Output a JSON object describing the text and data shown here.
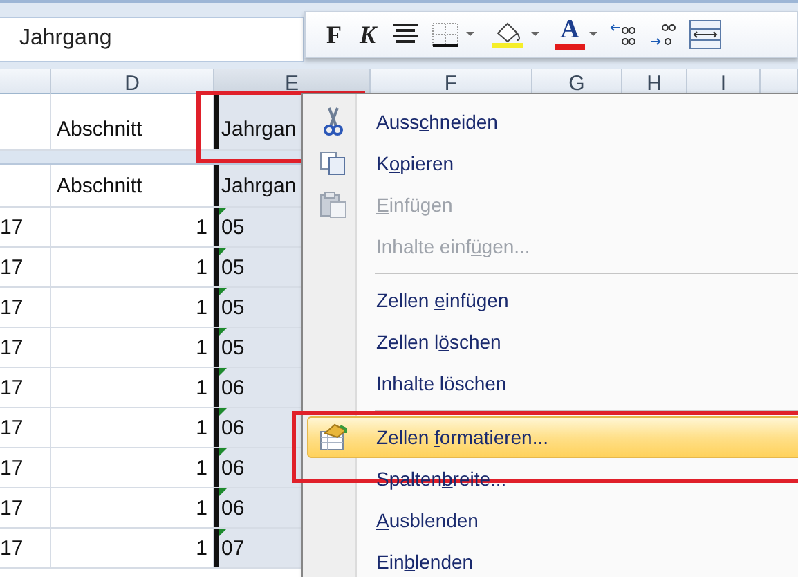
{
  "name_box": {
    "value": "Jahrgang"
  },
  "mini_toolbar": [
    {
      "kind": "bold",
      "label": "F"
    },
    {
      "kind": "italic",
      "label": "K"
    },
    {
      "kind": "align"
    },
    {
      "kind": "borders"
    },
    {
      "kind": "fill"
    },
    {
      "kind": "font_color",
      "label": "A"
    },
    {
      "kind": "more_decimals"
    },
    {
      "kind": "fewer_decimals"
    },
    {
      "kind": "merge"
    }
  ],
  "columns": [
    {
      "label": "D",
      "selected": false
    },
    {
      "label": "E",
      "selected": true
    },
    {
      "label": "F",
      "selected": false
    },
    {
      "label": "G",
      "selected": false
    },
    {
      "label": "H",
      "selected": false
    },
    {
      "label": "I",
      "selected": false
    }
  ],
  "header_rows": [
    {
      "kind": "top",
      "d": "Abschnitt",
      "e": "Jahrgan",
      "framed": true
    },
    {
      "kind": "table",
      "d": "Abschnitt",
      "e": "Jahrgan",
      "framed": false
    }
  ],
  "rows": [
    {
      "c": "17",
      "d": "1",
      "e": "05",
      "warning": true
    },
    {
      "c": "17",
      "d": "1",
      "e": "05",
      "warning": true
    },
    {
      "c": "17",
      "d": "1",
      "e": "05",
      "warning": true
    },
    {
      "c": "17",
      "d": "1",
      "e": "05",
      "warning": true
    },
    {
      "c": "17",
      "d": "1",
      "e": "06",
      "warning": true
    },
    {
      "c": "17",
      "d": "1",
      "e": "06",
      "warning": true
    },
    {
      "c": "17",
      "d": "1",
      "e": "06",
      "warning": true
    },
    {
      "c": "17",
      "d": "1",
      "e": "06",
      "warning": true
    },
    {
      "c": "17",
      "d": "1",
      "e": "07",
      "warning": true
    }
  ],
  "context_menu": [
    {
      "kind": "cut",
      "before": "Auss",
      "key": "c",
      "after": "hneiden",
      "disabled": false,
      "selected": false,
      "framed": false
    },
    {
      "kind": "copy",
      "before": "K",
      "key": "o",
      "after": "pieren",
      "disabled": false,
      "selected": false,
      "framed": false
    },
    {
      "kind": "paste",
      "key": "E",
      "after": "infügen",
      "disabled": true,
      "selected": false,
      "framed": false
    },
    {
      "kind": "item",
      "before": "Inhalte einf",
      "key": "ü",
      "after": "gen...",
      "disabled": true,
      "selected": false,
      "framed": false
    },
    {
      "kind": "separator"
    },
    {
      "kind": "item",
      "before": "Zellen ",
      "key": "e",
      "after": "infügen",
      "disabled": false,
      "selected": false,
      "framed": false
    },
    {
      "kind": "item",
      "before": "Zellen l",
      "key": "ö",
      "after": "schen",
      "disabled": false,
      "selected": false,
      "framed": false
    },
    {
      "kind": "item",
      "before": "Inhalte löschen",
      "disabled": false,
      "selected": false,
      "framed": false
    },
    {
      "kind": "separator"
    },
    {
      "kind": "format",
      "before": "Zellen ",
      "key": "f",
      "after": "ormatieren...",
      "disabled": false,
      "selected": true,
      "framed": true
    },
    {
      "kind": "item",
      "before": "Spalten",
      "key": "b",
      "after": "reite...",
      "disabled": false,
      "selected": false,
      "framed": false
    },
    {
      "kind": "item",
      "key": "A",
      "after": "usblenden",
      "disabled": false,
      "selected": false,
      "framed": false
    },
    {
      "kind": "item",
      "before": "Ein",
      "key": "b",
      "after": "lenden",
      "disabled": false,
      "selected": false,
      "framed": false
    }
  ]
}
